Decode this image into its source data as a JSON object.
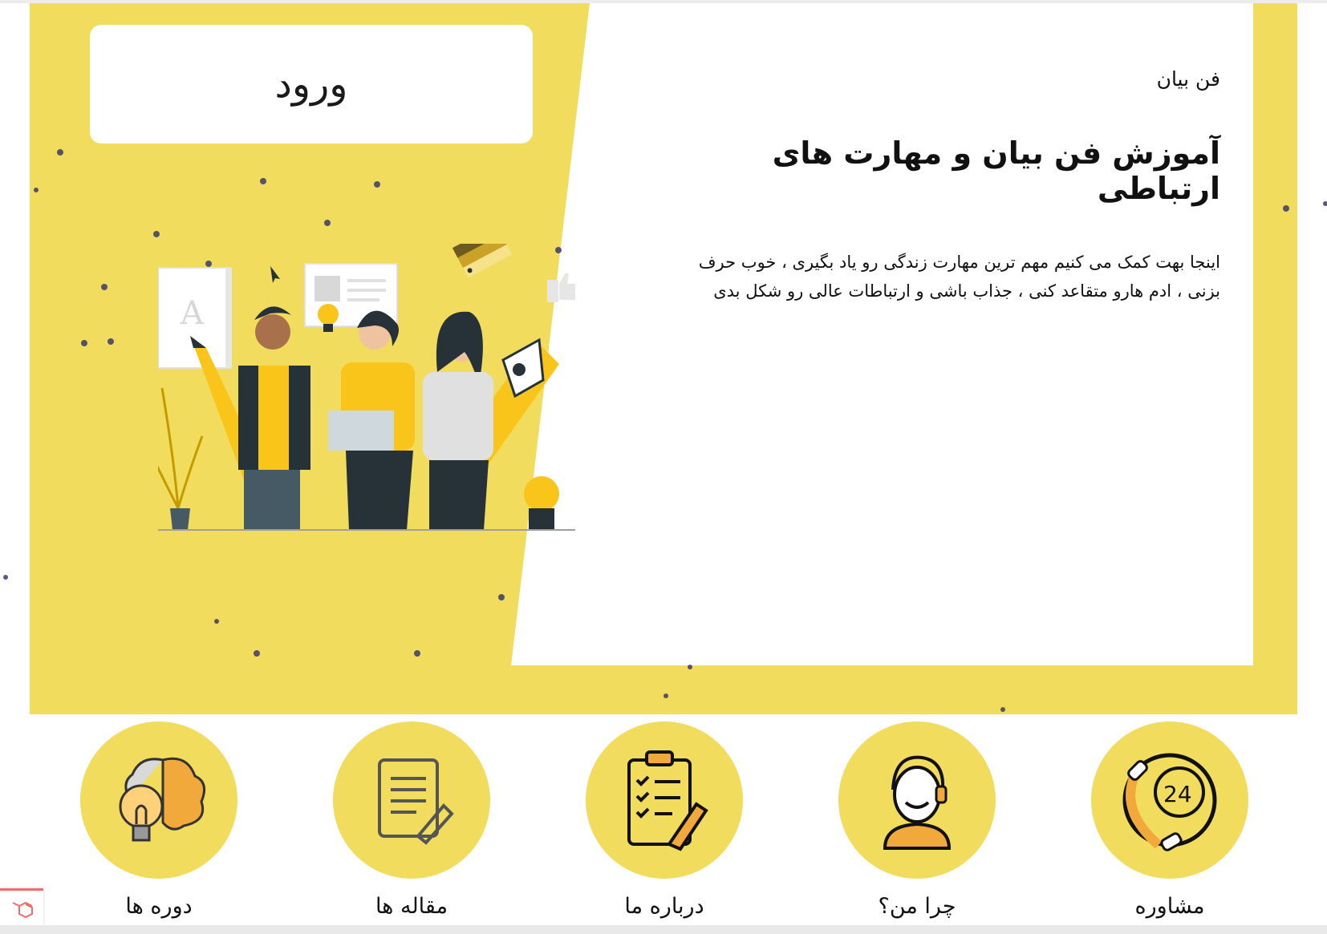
{
  "header": {
    "login_label": "ورود"
  },
  "hero": {
    "eyebrow": "فن بیان",
    "headline": "آموزش فن بیان و مهارت های ارتباطی",
    "description": "اینجا بهت کمک می کنیم مهم ترین مهارت زندگی رو یاد بگیری ، خوب حرف بزنی ، ادم هارو متقاعد کنی ، جذاب باشی و ارتباطات عالی رو شکل بدی",
    "illustration": "team-with-pencil-illustration",
    "letter_glyph": "A"
  },
  "features": [
    {
      "label": "دوره ها",
      "icon": "brain-lightbulb-icon"
    },
    {
      "label": "مقاله ها",
      "icon": "article-edit-icon"
    },
    {
      "label": "درباره ما",
      "icon": "clipboard-checklist-icon"
    },
    {
      "label": "چرا من؟",
      "icon": "support-agent-icon"
    },
    {
      "label": "مشاوره",
      "icon": "phone-24-icon"
    }
  ],
  "colors": {
    "accent": "#f2dc5d",
    "text": "#111111",
    "dark": "#263238"
  }
}
